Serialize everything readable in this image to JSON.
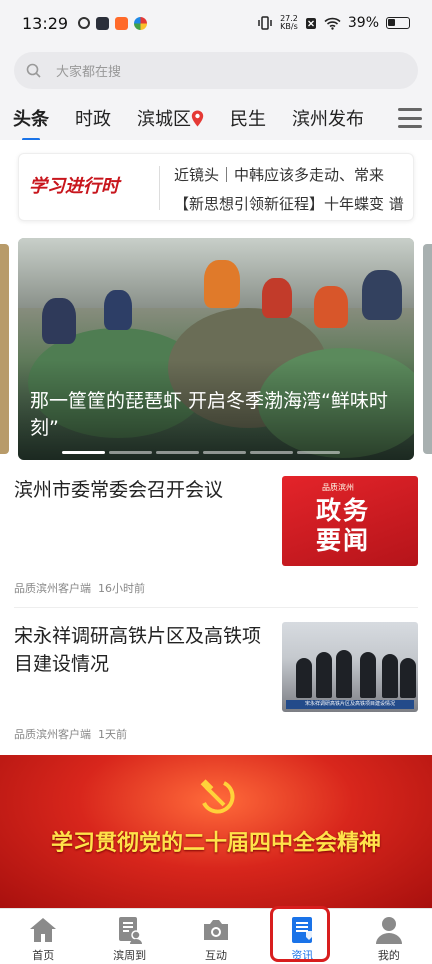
{
  "status_bar": {
    "time": "13:29",
    "net_speed_value": "27.2",
    "net_speed_unit": "KB/s",
    "battery": "39%"
  },
  "search": {
    "placeholder": "大家都在搜"
  },
  "tabs": [
    {
      "label": "头条",
      "active": true
    },
    {
      "label": "时政",
      "active": false
    },
    {
      "label": "滨城区",
      "active": false,
      "icon": "location-pin-icon"
    },
    {
      "label": "民生",
      "active": false
    },
    {
      "label": "滨州发布",
      "active": false
    }
  ],
  "promo": {
    "logo_text": "学习进行时",
    "lines": [
      "近镜头｜中韩应该多走动、常来",
      "【新思想引领新征程】十年蝶变 谱"
    ]
  },
  "carousel": {
    "caption": "那一筐筐的琵琶虾 开启冬季渤海湾“鲜味时刻”",
    "slide_count": 6,
    "active_index": 0
  },
  "news": [
    {
      "title": "滨州市委常委会召开会议",
      "source": "品质滨州客户端",
      "time": "16小时前",
      "thumb": {
        "brand": "品质滨州",
        "text_line1": "政务",
        "text_line2": "要闻"
      }
    },
    {
      "title": "宋永祥调研高铁片区及高铁项目建设情况",
      "source": "品质滨州客户端",
      "time": "1天前",
      "thumb": {
        "caption": "宋永祥调研高铁片区及高铁项目建设情况"
      }
    }
  ],
  "banner": {
    "text": "学习贯彻党的二十届四中全会精神"
  },
  "bottom_nav": [
    {
      "label": "首页",
      "icon": "home-icon",
      "active": false
    },
    {
      "label": "滨周到",
      "icon": "document-user-icon",
      "active": false
    },
    {
      "label": "互动",
      "icon": "camera-icon",
      "active": false
    },
    {
      "label": "资讯",
      "icon": "news-book-icon",
      "active": true
    },
    {
      "label": "我的",
      "icon": "person-icon",
      "active": false
    }
  ],
  "colors": {
    "accent": "#1a73e8",
    "party_red": "#d8261c",
    "highlight": "#d81e1e"
  }
}
